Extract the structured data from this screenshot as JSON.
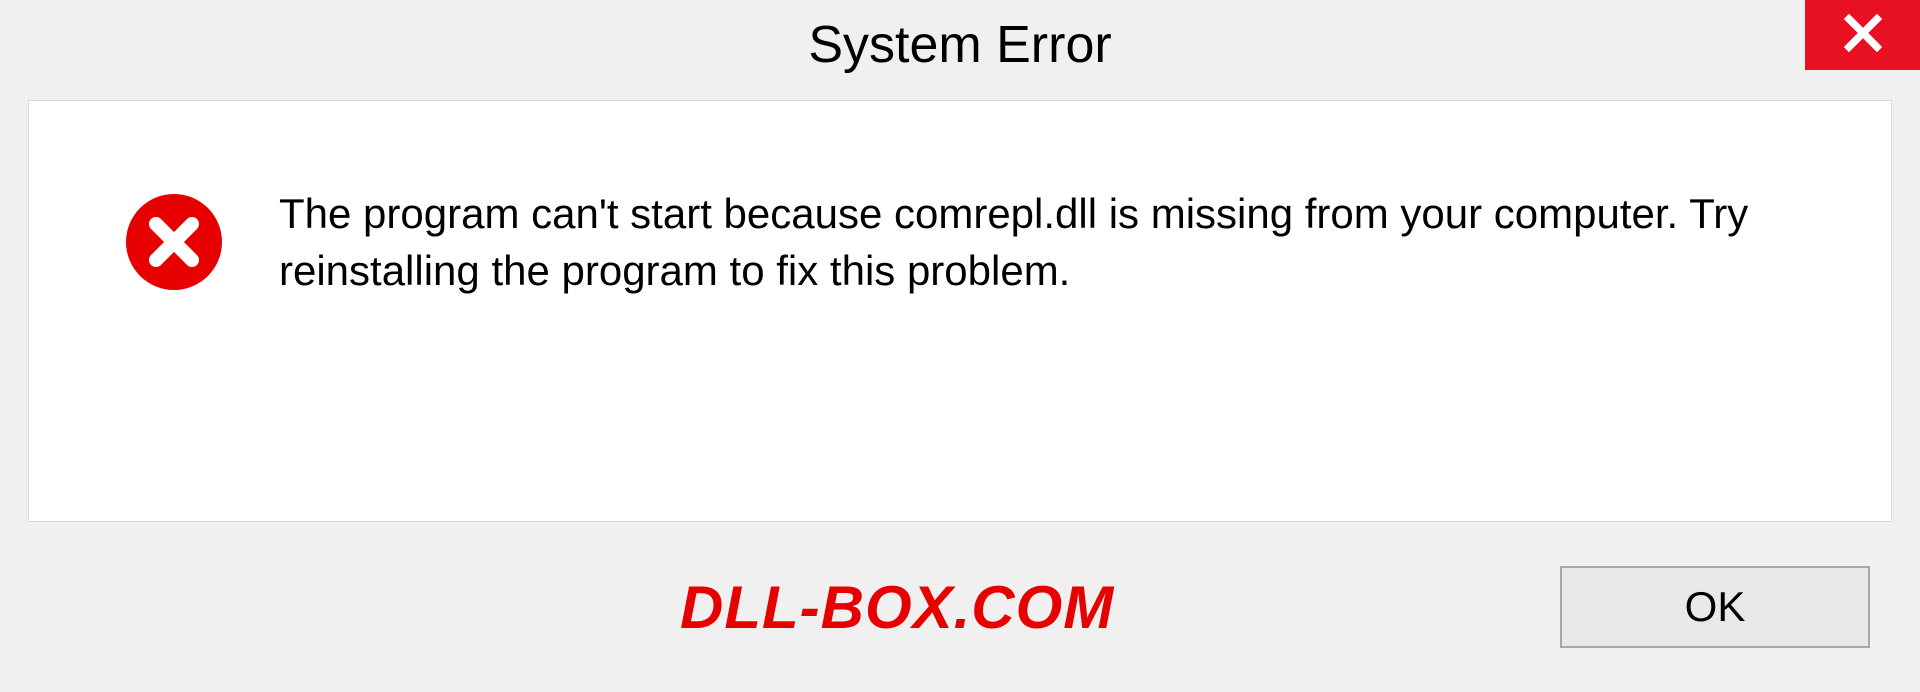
{
  "dialog": {
    "title": "System Error",
    "message": "The program can't start because comrepl.dll is missing from your computer. Try reinstalling the program to fix this problem.",
    "ok_label": "OK"
  },
  "watermark": "DLL-BOX.COM"
}
